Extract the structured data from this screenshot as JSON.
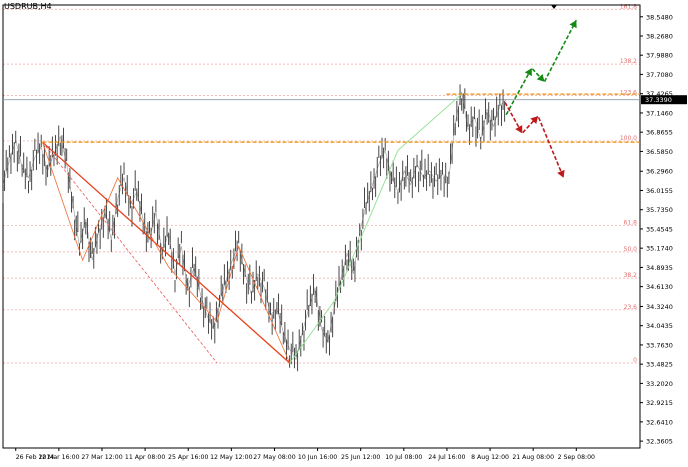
{
  "chart_data": {
    "type": "candlestick",
    "title": "USDRUB,H4",
    "current_price": "37.3390",
    "y_ticks": [
      "38.5480",
      "38.2680",
      "37.9880",
      "37.7080",
      "37.4265",
      "37.1460",
      "36.8655",
      "36.5850",
      "36.2960",
      "36.0155",
      "35.7350",
      "35.4545",
      "35.1740",
      "34.8935",
      "34.6130",
      "34.3240",
      "34.0435",
      "33.7630",
      "33.4825",
      "33.2020",
      "32.9215",
      "32.6410",
      "32.3605"
    ],
    "x_ticks": [
      "26 Feb 2014",
      "12 Mar 16:00",
      "27 Mar 12:00",
      "11 Apr 08:00",
      "25 Apr 16:00",
      "12 May 12:00",
      "27 May 08:00",
      "10 Jun 16:00",
      "25 Jun 12:00",
      "10 Jul 08:00",
      "24 Jul 16:00",
      "8 Aug 12:00",
      "21 Aug 08:00",
      "2 Sep 08:00"
    ],
    "ylim": [
      32.26,
      38.72
    ],
    "x_range": [
      0,
      100
    ],
    "fib_levels": [
      {
        "label": "161.8",
        "price": 38.658
      },
      {
        "label": "138.2",
        "price": 37.858
      },
      {
        "label": "123.6",
        "price": 37.4
      },
      {
        "label": "100.0",
        "price": 36.738
      },
      {
        "label": "61.8",
        "price": 35.502
      },
      {
        "label": "50.0",
        "price": 35.12
      },
      {
        "label": "38.2",
        "price": 34.737
      },
      {
        "label": "23.6",
        "price": 34.275
      },
      {
        "label": "0",
        "price": 33.5
      }
    ],
    "price_series": [
      [
        0,
        36.1
      ],
      [
        1,
        36.45
      ],
      [
        2,
        36.75
      ],
      [
        3,
        36.35
      ],
      [
        4,
        36.2
      ],
      [
        5,
        36.5
      ],
      [
        6,
        36.65
      ],
      [
        7,
        36.3
      ],
      [
        8,
        36.55
      ],
      [
        9,
        36.8
      ],
      [
        10,
        36.4
      ],
      [
        11,
        35.8
      ],
      [
        12,
        35.2
      ],
      [
        13,
        35.6
      ],
      [
        14,
        35.0
      ],
      [
        15,
        35.4
      ],
      [
        16,
        35.7
      ],
      [
        17,
        35.3
      ],
      [
        18,
        35.9
      ],
      [
        19,
        36.2
      ],
      [
        20,
        35.8
      ],
      [
        21,
        36.0
      ],
      [
        22,
        35.6
      ],
      [
        23,
        35.3
      ],
      [
        24,
        35.7
      ],
      [
        25,
        35.1
      ],
      [
        26,
        35.4
      ],
      [
        27,
        34.8
      ],
      [
        28,
        35.2
      ],
      [
        29,
        34.6
      ],
      [
        30,
        34.9
      ],
      [
        31,
        34.5
      ],
      [
        32,
        34.2
      ],
      [
        33,
        34.0
      ],
      [
        34,
        34.4
      ],
      [
        35,
        34.7
      ],
      [
        36,
        35.0
      ],
      [
        37,
        35.2
      ],
      [
        38,
        34.8
      ],
      [
        39,
        34.5
      ],
      [
        40,
        34.8
      ],
      [
        41,
        34.6
      ],
      [
        42,
        34.2
      ],
      [
        43,
        34.3
      ],
      [
        44,
        33.95
      ],
      [
        45,
        33.7
      ],
      [
        46,
        33.55
      ],
      [
        47,
        33.95
      ],
      [
        48,
        34.3
      ],
      [
        49,
        34.6
      ],
      [
        50,
        34.0
      ],
      [
        51,
        33.8
      ],
      [
        52,
        34.3
      ],
      [
        53,
        34.7
      ],
      [
        54,
        35.1
      ],
      [
        55,
        34.8
      ],
      [
        56,
        35.4
      ],
      [
        57,
        35.8
      ],
      [
        58,
        36.1
      ],
      [
        59,
        36.4
      ],
      [
        60,
        36.6
      ],
      [
        61,
        36.2
      ],
      [
        62,
        36.0
      ],
      [
        63,
        36.3
      ],
      [
        64,
        36.1
      ],
      [
        65,
        36.4
      ],
      [
        66,
        36.2
      ],
      [
        67,
        36.3
      ],
      [
        68,
        36.15
      ],
      [
        69,
        36.25
      ],
      [
        70,
        36.2
      ],
      [
        71,
        37.0
      ],
      [
        72,
        37.45
      ],
      [
        73,
        36.9
      ],
      [
        74,
        37.1
      ],
      [
        75,
        36.75
      ],
      [
        76,
        37.2
      ],
      [
        77,
        36.95
      ],
      [
        78,
        37.25
      ],
      [
        79,
        37.34
      ]
    ],
    "support_lines": [
      {
        "price": 37.42,
        "x_from": 69.6,
        "x_to": 100
      },
      {
        "price": 36.72,
        "x_from": 6.2,
        "x_to": 100
      }
    ],
    "trend_line": [
      [
        6.2,
        36.72
      ],
      [
        45.0,
        33.5
      ]
    ],
    "trend_channel": [
      [
        6.2,
        36.72
      ],
      [
        33.6,
        33.5
      ]
    ],
    "green_wave": [
      [
        45.0,
        33.5
      ],
      [
        52.0,
        34.4
      ],
      [
        62.0,
        36.6
      ],
      [
        72.0,
        37.42
      ]
    ],
    "zigzag_lines": [
      [
        [
          6.2,
          36.72
        ],
        [
          12.5,
          35.0
        ],
        [
          18.0,
          36.2
        ],
        [
          26.0,
          34.9
        ],
        [
          33.6,
          34.1
        ],
        [
          37.0,
          35.2
        ],
        [
          45.0,
          33.5
        ]
      ]
    ],
    "projection_up": [
      [
        79.0,
        37.12
      ],
      [
        83.0,
        37.8
      ],
      [
        85.0,
        37.6
      ],
      [
        90.0,
        38.5
      ]
    ],
    "projection_down": [
      [
        78.8,
        37.3
      ],
      [
        81.5,
        36.85
      ],
      [
        84.0,
        37.1
      ],
      [
        88.0,
        36.2
      ]
    ]
  }
}
